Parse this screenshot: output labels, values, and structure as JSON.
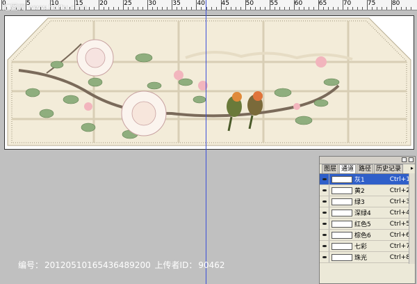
{
  "ruler": {
    "numbers": [
      "0",
      "5",
      "10",
      "15",
      "20",
      "25",
      "30",
      "35",
      "40",
      "45",
      "50",
      "55",
      "60",
      "65",
      "70",
      "75",
      "80"
    ]
  },
  "watermark_top": "汇图网 www.huitu.com",
  "footer": {
    "id_label": "编号：",
    "id_value": "20120510165436489200",
    "uploader_label": "上传者ID：",
    "uploader_value": "90462"
  },
  "channels_panel": {
    "tabs": [
      "图层",
      "通道",
      "路径",
      "历史记录"
    ],
    "active_tab": "通道",
    "menu_icon": "triangle-right-icon",
    "rows": [
      {
        "name": "灰1",
        "shortcut": "Ctrl+1",
        "selected": true
      },
      {
        "name": "黄2",
        "shortcut": "Ctrl+2",
        "selected": false
      },
      {
        "name": "绿3",
        "shortcut": "Ctrl+3",
        "selected": false
      },
      {
        "name": "深绿4",
        "shortcut": "Ctrl+4",
        "selected": false
      },
      {
        "name": "红色5",
        "shortcut": "Ctrl+5",
        "selected": false
      },
      {
        "name": "棕色6",
        "shortcut": "Ctrl+6",
        "selected": false
      },
      {
        "name": "七彩",
        "shortcut": "Ctrl+7",
        "selected": false
      },
      {
        "name": "珠光",
        "shortcut": "Ctrl+8",
        "selected": false
      }
    ]
  },
  "colors": {
    "selection": "#2f5fc9",
    "guide": "#3b4fd8",
    "workspace": "#c0c0c0"
  }
}
